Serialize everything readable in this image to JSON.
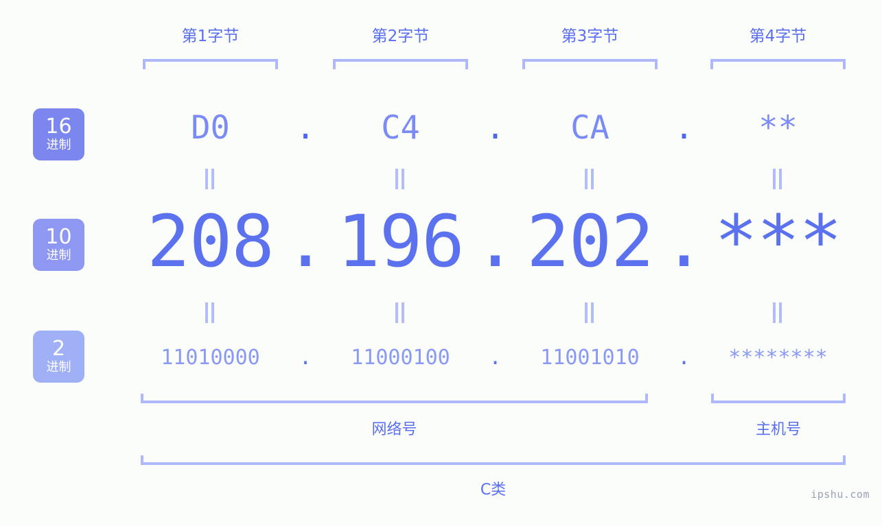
{
  "background_color": "#fbfdfa",
  "accent_colors": {
    "bracket": "#aeb8fb",
    "label_text": "#5a6ef0",
    "hex_value": "#7b8bf5",
    "dec_value": "#5c71ee",
    "bin_value": "#8a99f3",
    "badge_hex": "#7b86ee",
    "badge_dec": "#8e98f2",
    "badge_bin": "#9fb0f6"
  },
  "byte_headers": [
    {
      "label": "第1字节"
    },
    {
      "label": "第2字节"
    },
    {
      "label": "第3字节"
    },
    {
      "label": "第4字节"
    }
  ],
  "bases": [
    {
      "number": "16",
      "system": "进制"
    },
    {
      "number": "10",
      "system": "进制"
    },
    {
      "number": "2",
      "system": "进制"
    }
  ],
  "rows": {
    "hex": {
      "base_number": "16",
      "base_system": "进制",
      "values": [
        "D0",
        "C4",
        "CA",
        "**"
      ],
      "separator": "."
    },
    "decimal": {
      "base_number": "10",
      "base_system": "进制",
      "values": [
        "208",
        "196",
        "202",
        "***"
      ],
      "separator": "."
    },
    "binary": {
      "base_number": "2",
      "base_system": "进制",
      "values": [
        "11010000",
        "11000100",
        "11001010",
        "********"
      ],
      "separator": "."
    }
  },
  "equals_connectors": {
    "glyph": "||",
    "count_per_row": 4
  },
  "bottom": {
    "network_label": "网络号",
    "host_label": "主机号",
    "class_label": "C类"
  },
  "watermark": "ipshu.com"
}
